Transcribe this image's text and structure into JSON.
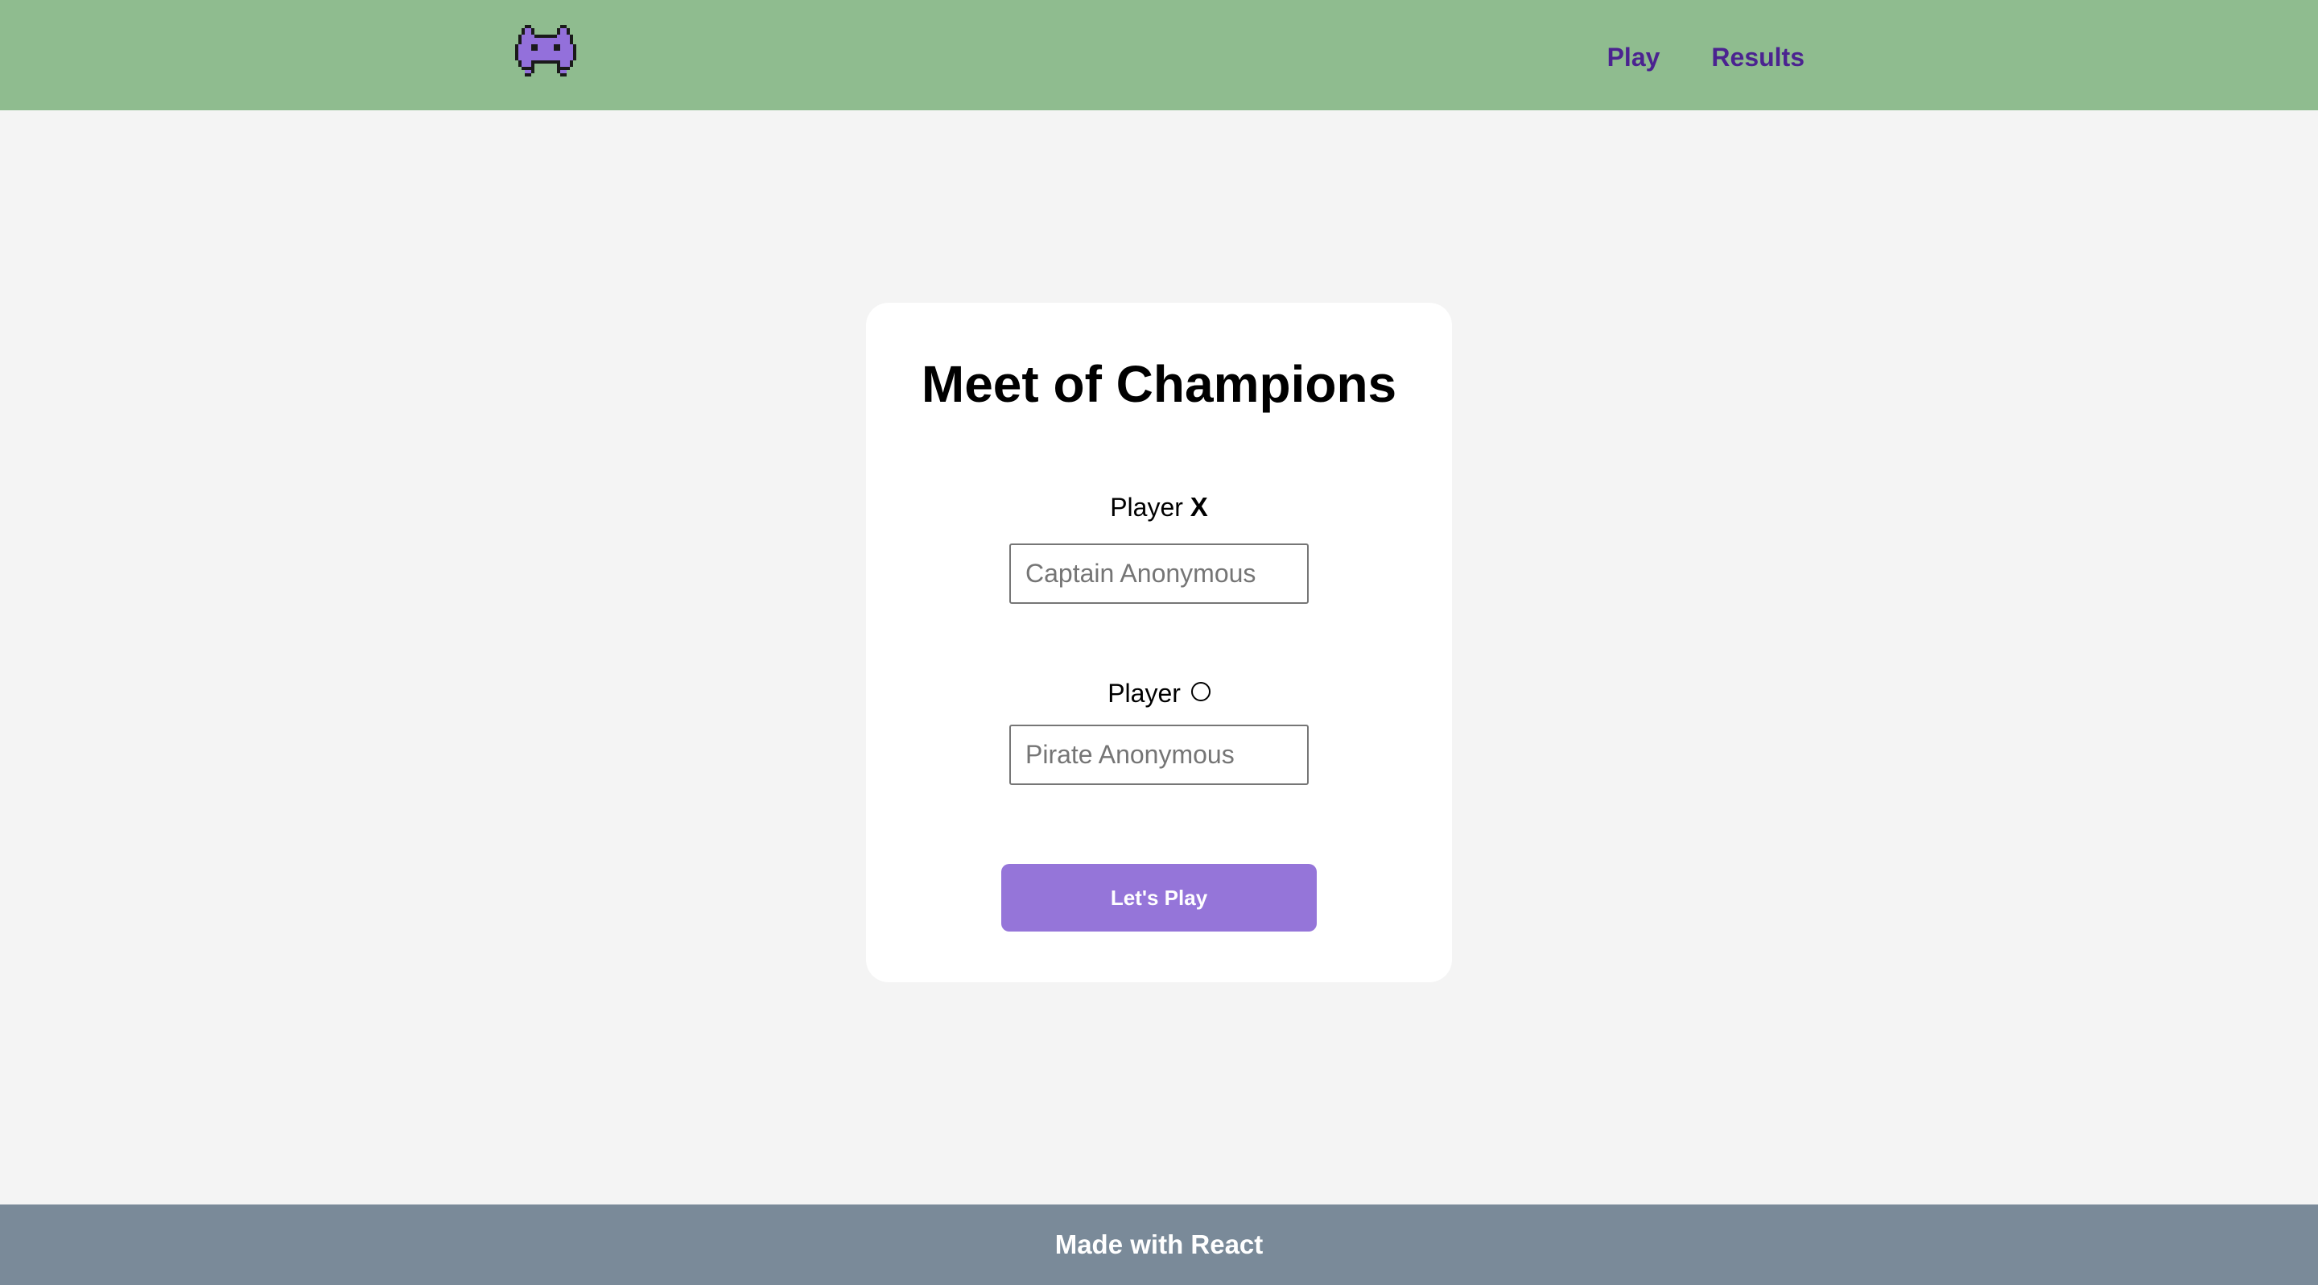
{
  "header": {
    "logo_icon": "space-invader-icon",
    "logo_color": "#9370db",
    "background": "#8fbc8f",
    "nav": [
      {
        "label": "Play"
      },
      {
        "label": "Results"
      }
    ],
    "nav_color": "#4b2390"
  },
  "card": {
    "title": "Meet of Champions",
    "player_x": {
      "label": "Player",
      "mark": "X",
      "placeholder": "Captain Anonymous",
      "value": ""
    },
    "player_o": {
      "label": "Player",
      "mark_icon": "circle-o-icon",
      "placeholder": "Pirate Anonymous",
      "value": ""
    },
    "submit_label": "Let's Play",
    "submit_color": "#9575d9"
  },
  "footer": {
    "text": "Made with React",
    "background": "#7a8a99"
  }
}
